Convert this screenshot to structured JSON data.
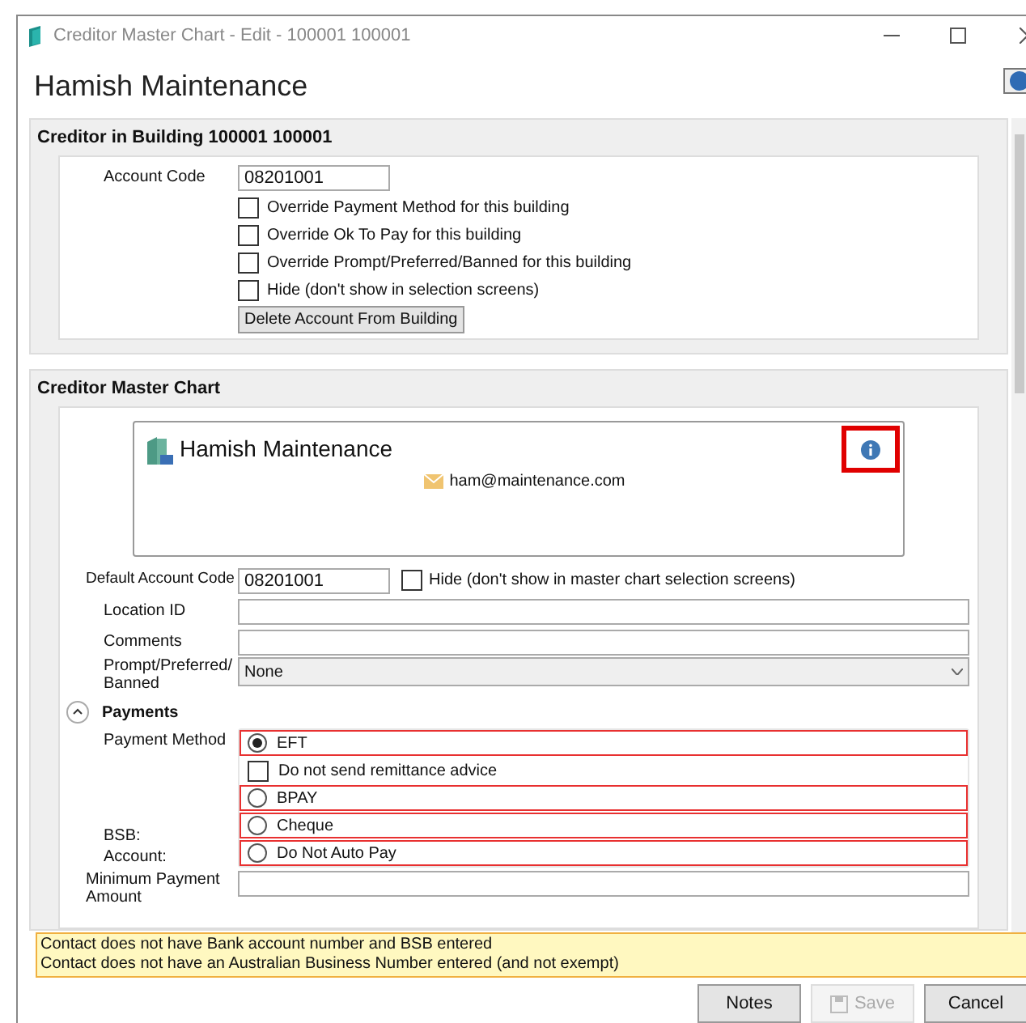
{
  "window": {
    "title": "Creditor Master Chart - Edit - 100001 100001"
  },
  "heading": "Hamish Maintenance",
  "building_section": {
    "title": "Creditor in Building 100001 100001",
    "account_code_label": "Account Code",
    "account_code_value": "08201001",
    "checkboxes": [
      {
        "label": "Override Payment Method for this building",
        "checked": false
      },
      {
        "label": "Override Ok To Pay for this building",
        "checked": false
      },
      {
        "label": "Override Prompt/Preferred/Banned for this building",
        "checked": false
      },
      {
        "label": "Hide (don't show in selection screens)",
        "checked": false
      }
    ],
    "delete_button": "Delete Account From Building"
  },
  "master_section": {
    "title": "Creditor Master Chart",
    "card": {
      "name": "Hamish Maintenance",
      "email": "ham@maintenance.com",
      "info_highlighted": true
    },
    "default_account_label": "Default Account Code",
    "default_account_value": "08201001",
    "hide_checkbox": {
      "label": "Hide (don't show in master chart selection screens)",
      "checked": false
    },
    "location_label": "Location ID",
    "comments_label": "Comments",
    "prompt_label": "Prompt/Preferred/ Banned",
    "prompt_value": "None",
    "payments": {
      "title": "Payments",
      "expanded": true
    },
    "payment_method_label": "Payment Method",
    "options": [
      {
        "kind": "radio",
        "label": "EFT",
        "selected": true,
        "invalid": true
      },
      {
        "kind": "checkbox",
        "label": "Do not send remittance advice",
        "checked": false,
        "invalid": false
      },
      {
        "kind": "radio",
        "label": "BPAY",
        "selected": false,
        "invalid": true
      },
      {
        "kind": "radio",
        "label": "Cheque",
        "selected": false,
        "invalid": true
      },
      {
        "kind": "radio",
        "label": "Do Not Auto Pay",
        "selected": false,
        "invalid": true
      }
    ],
    "bsb_label": "BSB:",
    "account_label": "Account:",
    "min_payment_label": "Minimum Payment Amount"
  },
  "warnings": [
    "Contact does not have Bank account number and BSB entered",
    "Contact does not have an Australian Business Number entered (and not exempt)"
  ],
  "buttons": [
    {
      "label": "Notes",
      "disabled": false,
      "icon": false
    },
    {
      "label": "Save",
      "disabled": true,
      "icon": true
    },
    {
      "label": "Cancel",
      "disabled": false,
      "icon": false
    }
  ]
}
